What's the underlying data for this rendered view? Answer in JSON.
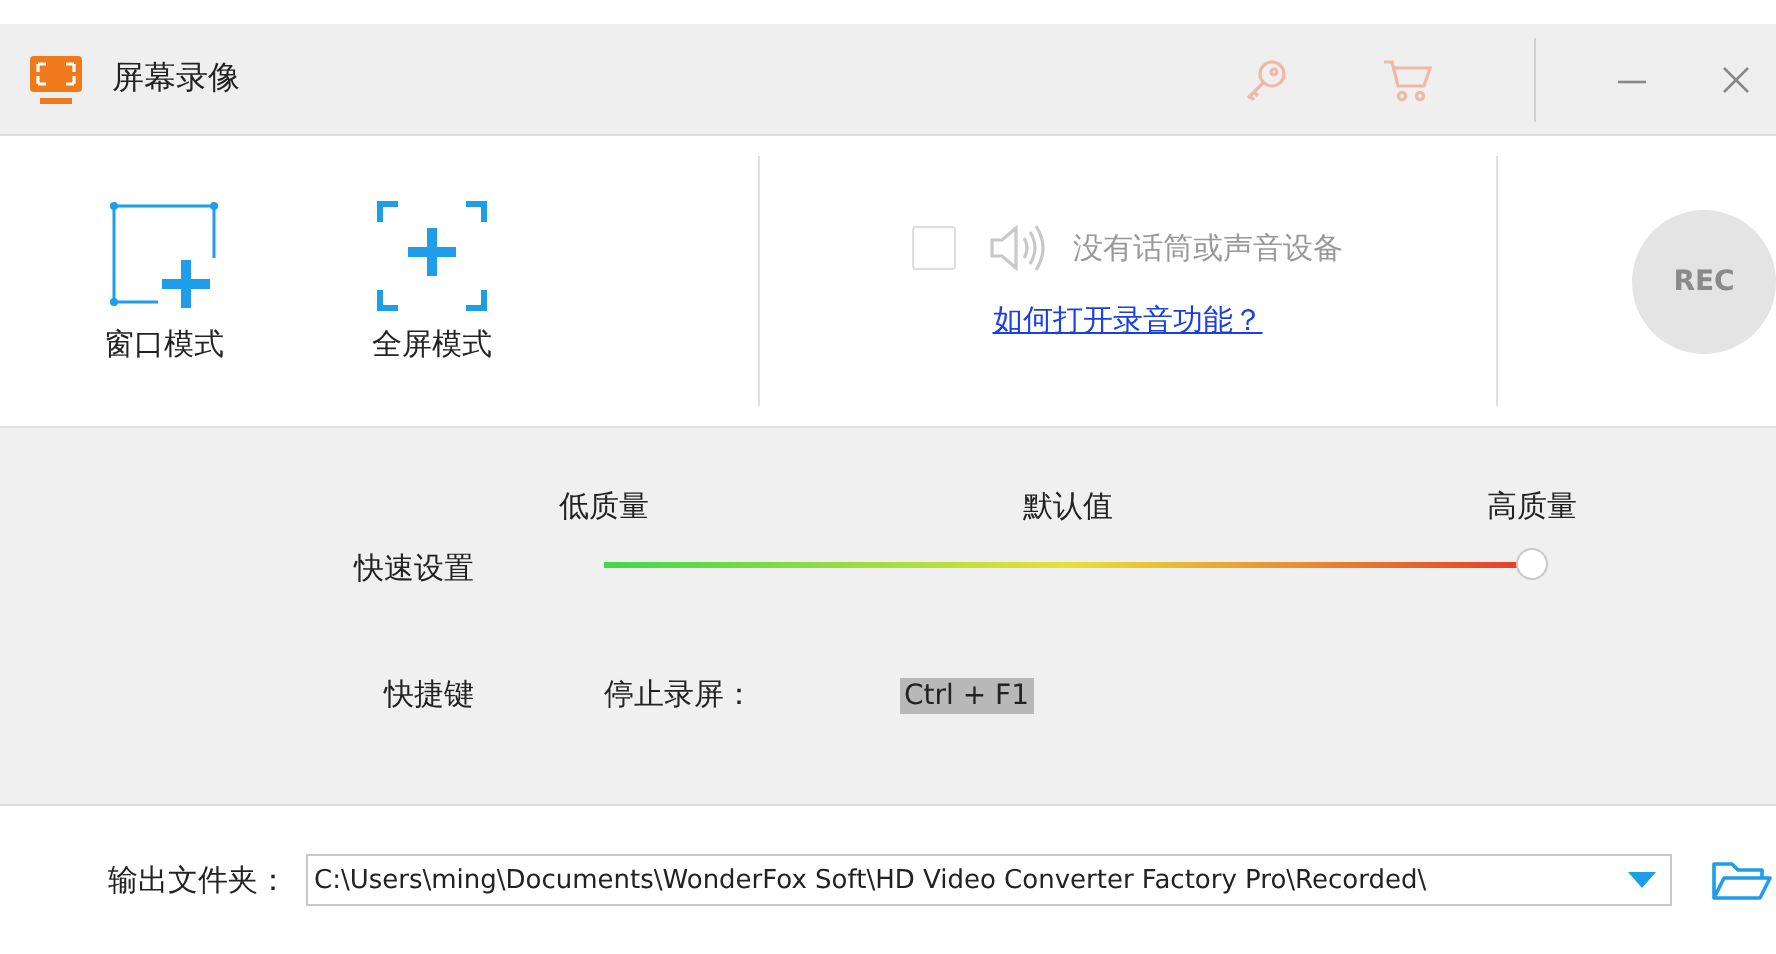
{
  "window": {
    "title": "屏幕录像"
  },
  "modes": [
    {
      "label": "窗口模式",
      "kind": "window"
    },
    {
      "label": "全屏模式",
      "kind": "fullscreen"
    }
  ],
  "audio": {
    "checked": false,
    "label": "没有话筒或声音设备",
    "help_link": "如何打开录音功能？"
  },
  "rec_button": {
    "label": "REC",
    "disabled": true
  },
  "quick_settings": {
    "label": "快速设置",
    "ticks": [
      "低质量",
      "默认值",
      "高质量"
    ],
    "level": 1
  },
  "hotkey": {
    "label": "快捷键",
    "action": "停止录屏：",
    "keys": "Ctrl + F1"
  },
  "output": {
    "label": "输出文件夹：",
    "path": "C:\\Users\\ming\\Documents\\WonderFox Soft\\HD Video Converter Factory Pro\\Recorded\\"
  }
}
